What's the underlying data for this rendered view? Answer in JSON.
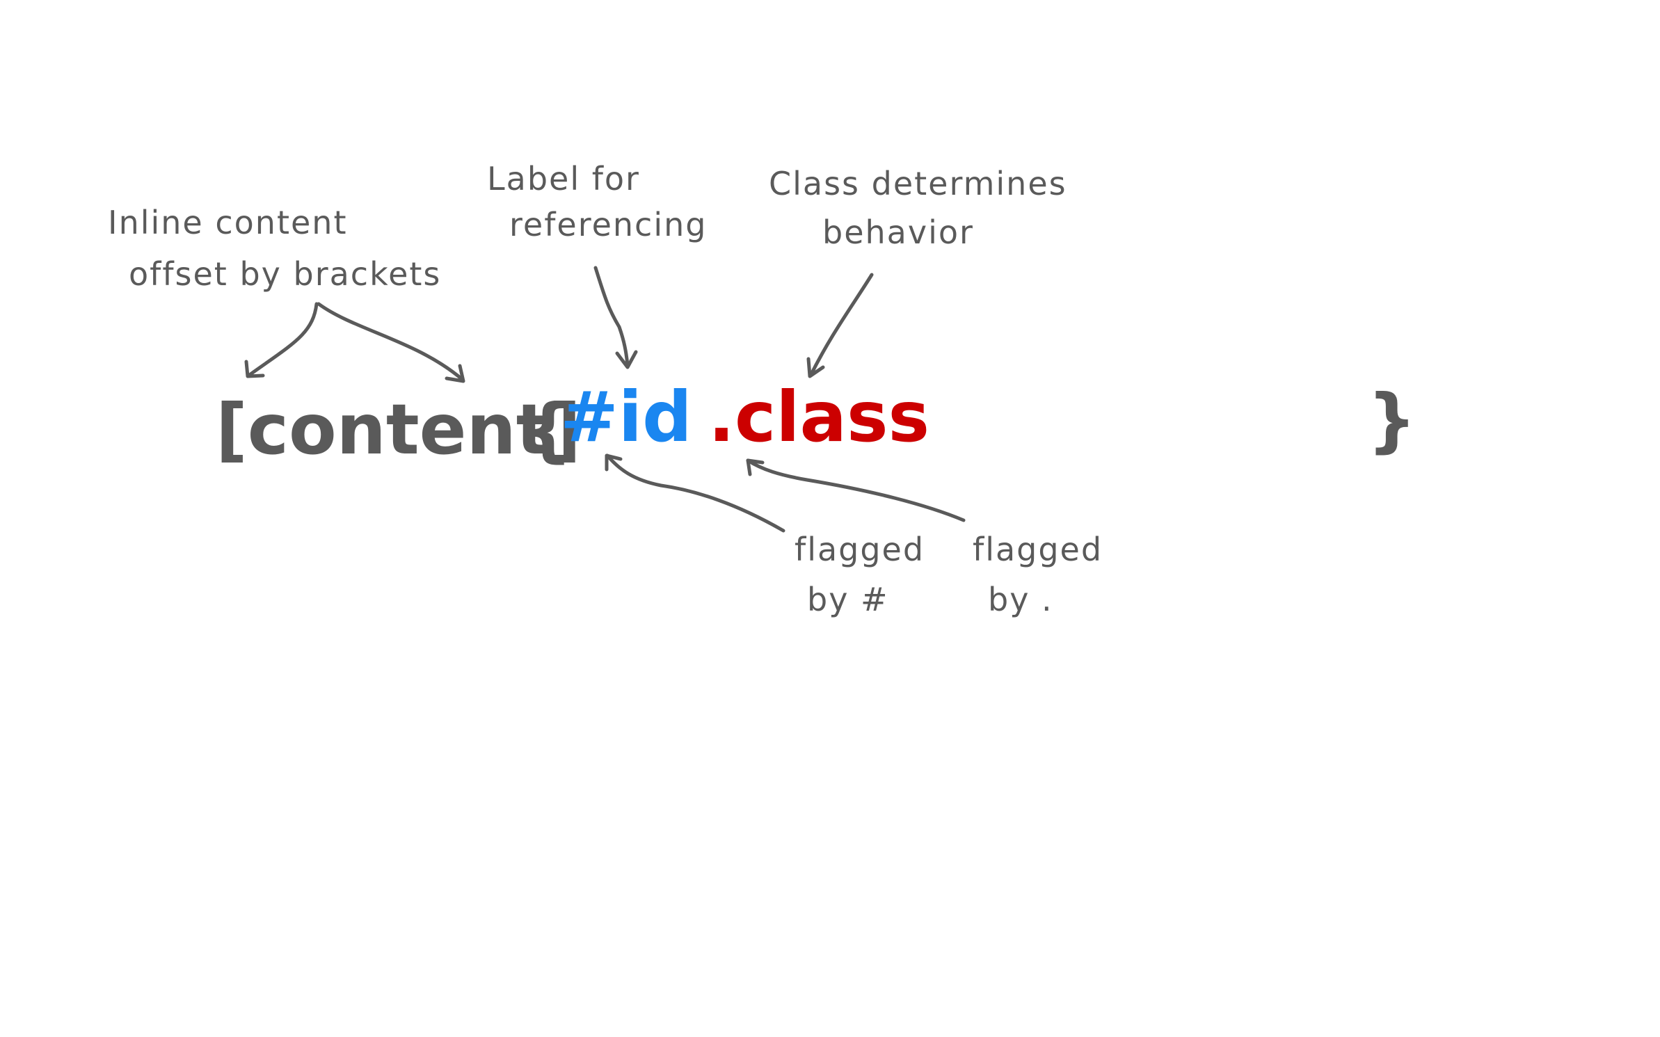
{
  "annotations": {
    "content_note": [
      "Inline content",
      "offset by brackets"
    ],
    "id_note": [
      "Label for",
      "referencing"
    ],
    "class_note": [
      "Class determines",
      "behavior"
    ],
    "id_flag_note": [
      "flagged",
      "by #"
    ],
    "class_flag_note": [
      "flagged",
      "by ."
    ]
  },
  "syntax": {
    "content": "[content]",
    "open_brace": "{",
    "id": "#id",
    "class": ".class",
    "close_brace": "}"
  },
  "colors": {
    "ink": "#5a5a5a",
    "id": "#1a86f0",
    "class": "#cc0000",
    "background": "#ffffff"
  }
}
